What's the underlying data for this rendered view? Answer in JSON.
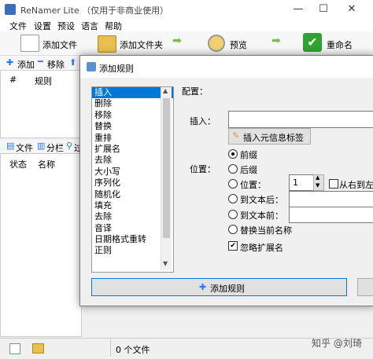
{
  "app": {
    "title": "ReNamer Lite （仅用于非商业使用）"
  },
  "window_controls": {
    "minimize": "—",
    "maximize": "☐",
    "close": "✕"
  },
  "menu": [
    "文件",
    "设置",
    "预设",
    "语言",
    "帮助"
  ],
  "toolbar": {
    "add_files": "添加文件",
    "add_folder": "添加文件夹",
    "preview": "预览",
    "rename": "重命名"
  },
  "rules_panel": {
    "add": "添加",
    "remove": "移除",
    "col_num": "#",
    "col_rule": "规则"
  },
  "files_panel": {
    "files": "文件",
    "columns": "分栏",
    "filter": "过",
    "col_status": "状态",
    "col_name": "名称"
  },
  "status_bar": {
    "file_count": "0 个文件"
  },
  "dialog": {
    "title": "添加规则",
    "config_label": "配置：",
    "insert_label": "插入：",
    "insert_meta_button": "插入元信息标签",
    "position_label": "位置：",
    "positions": [
      "前缀",
      "后缀",
      "位置：",
      "到文本后：",
      "到文本前：",
      "替换当前名称"
    ],
    "selected_position": "前缀",
    "position_value": "1",
    "right_to_left": "从右到左",
    "ignore_extension": "忽略扩展名",
    "ignore_extension_checked": true,
    "add_rule_button": "添加规则",
    "rules": [
      "插入",
      "删除",
      "移除",
      "替换",
      "重排",
      "扩展名",
      "去除",
      "大小写",
      "序列化",
      "随机化",
      "填充",
      "去除",
      "音译",
      "日期格式重转",
      "正则"
    ],
    "selected_rule": "插入"
  },
  "watermark": "知乎 @刘琦"
}
